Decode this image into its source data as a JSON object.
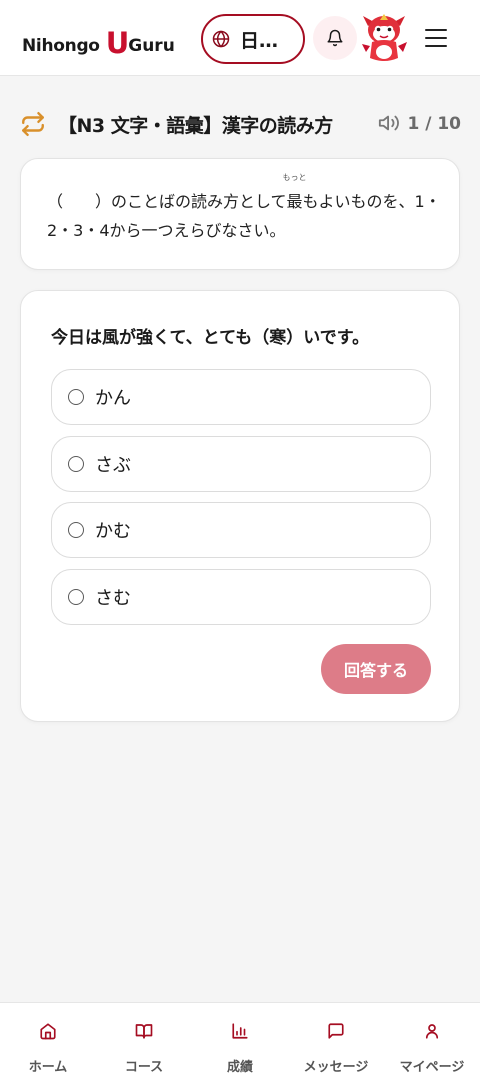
{
  "header": {
    "logo_text_left": "Nihongo",
    "logo_text_u": "U",
    "logo_text_right": "Guru",
    "language_label": "日…",
    "icons": {
      "language": "globe-icon",
      "notifications": "bell-icon",
      "avatar": "dragon-mascot",
      "menu": "hamburger-menu-icon"
    }
  },
  "quiz": {
    "title": "【N3 文字・語彙】漢字の読み方",
    "progress": "1 / 10",
    "instruction_before": "（　　）のことばの読み方として",
    "instruction_ruby_base": "最",
    "instruction_ruby_reading": "もっと",
    "instruction_after": "もよいものを、1・2・3・4から一つえらびなさい。",
    "question": "今日は風が強くて、とても（寒）いです。",
    "options": [
      {
        "label": "かん"
      },
      {
        "label": "さぶ"
      },
      {
        "label": "かむ"
      },
      {
        "label": "さむ"
      }
    ],
    "submit_label": "回答する"
  },
  "bottom_nav": {
    "items": [
      {
        "label": "ホーム",
        "icon": "home-icon"
      },
      {
        "label": "コース",
        "icon": "book-icon"
      },
      {
        "label": "成績",
        "icon": "bar-chart-icon"
      },
      {
        "label": "メッセージ",
        "icon": "message-icon"
      },
      {
        "label": "マイページ",
        "icon": "user-icon"
      }
    ]
  },
  "colors": {
    "brand_red": "#c8102e",
    "accent_dark_red": "#a50d22",
    "submit_disabled": "#dd7c88",
    "repeat_icon": "#d9902b",
    "page_bg": "#f5f5f5"
  }
}
